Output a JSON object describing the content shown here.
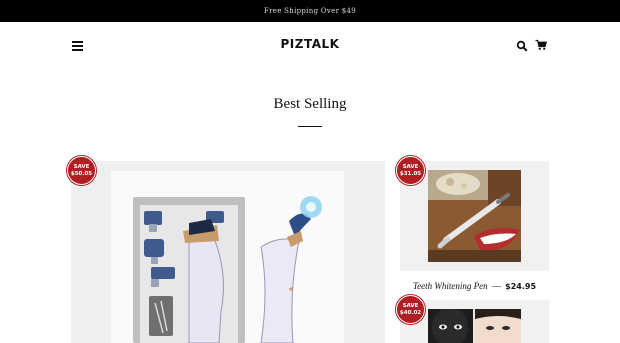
{
  "announcement": {
    "text": "Free Shipping Over $49"
  },
  "header": {
    "logo": "PIZTALK",
    "menu_icon": "hamburger-menu-icon",
    "search_icon": "search-icon",
    "cart_icon": "cart-icon"
  },
  "section": {
    "title": "Best Selling"
  },
  "products": [
    {
      "badge_line1": "SAVE",
      "badge_line2": "$50.05",
      "image": "blackhead-remover-kit"
    },
    {
      "badge_line1": "SAVE",
      "badge_line2": "$31.05",
      "image": "teeth-whitening-pen",
      "name": "Teeth Whitening Pen",
      "separator": "—",
      "price": "$24.95"
    },
    {
      "badge_line1": "SAVE",
      "badge_line2": "$40.02",
      "image": "face-mask-photo"
    }
  ],
  "colors": {
    "announcement_bg": "#000000",
    "badge": "#b01e23",
    "card_bg": "#efefef"
  }
}
